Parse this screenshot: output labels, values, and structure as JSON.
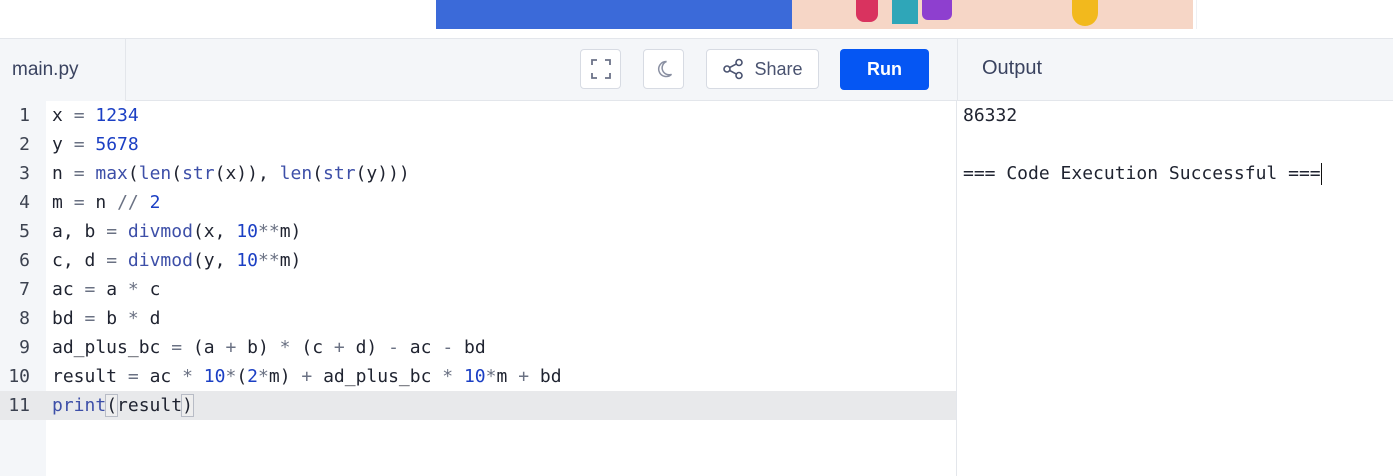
{
  "toolbar": {
    "file_name": "main.py",
    "share_label": "Share",
    "run_label": "Run",
    "output_label": "Output"
  },
  "icons": {
    "fullscreen": "fullscreen-icon",
    "theme": "moon-icon",
    "share": "share-icon"
  },
  "colors": {
    "run_button": "#0556f3",
    "number": "#1b3fc4",
    "builtin": "#3d4fa8"
  },
  "editor": {
    "lines": [
      {
        "num": "1",
        "text": "x = 1234"
      },
      {
        "num": "2",
        "text": "y = 5678"
      },
      {
        "num": "3",
        "text": "n = max(len(str(x)), len(str(y)))"
      },
      {
        "num": "4",
        "text": "m = n // 2"
      },
      {
        "num": "5",
        "text": "a, b = divmod(x, 10**m)"
      },
      {
        "num": "6",
        "text": "c, d = divmod(y, 10**m)"
      },
      {
        "num": "7",
        "text": "ac = a * c"
      },
      {
        "num": "8",
        "text": "bd = b * d"
      },
      {
        "num": "9",
        "text": "ad_plus_bc = (a + b) * (c + d) - ac - bd"
      },
      {
        "num": "10",
        "text": "result = ac * 10*(2*m) + ad_plus_bc * 10*m + bd"
      },
      {
        "num": "11",
        "text": "print(result)"
      }
    ],
    "active_line": 11
  },
  "output": {
    "lines": [
      "86332",
      "",
      "=== Code Execution Successful ==="
    ]
  }
}
